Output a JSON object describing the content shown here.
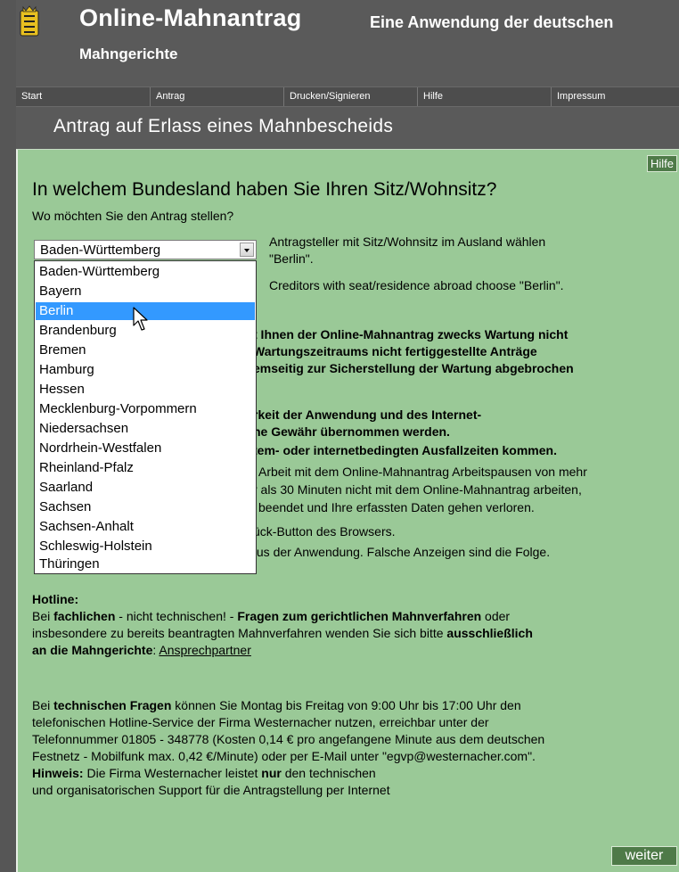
{
  "header": {
    "title": "Online-Mahnantrag",
    "subtitle": "Eine Anwendung der deutschen",
    "subtitle2": "Mahngerichte"
  },
  "nav": {
    "items": [
      "Start",
      "Antrag",
      "Drucken/Signieren",
      "Hilfe",
      "Impressum"
    ]
  },
  "page_title": "Antrag auf Erlass eines Mahnbescheids",
  "help_label": "Hilfe",
  "question": "In welchem Bundesland haben Sie Ihren Sitz/Wohnsitz?",
  "subquestion": "Wo möchten Sie den Antrag stellen?",
  "select": {
    "value": "Baden-Württemberg",
    "options": [
      "Baden-Württemberg",
      "Bayern",
      "Berlin",
      "Brandenburg",
      "Bremen",
      "Hamburg",
      "Hessen",
      "Mecklenburg-Vorpommern",
      "Niedersachsen",
      "Nordrhein-Westfalen",
      "Rheinland-Pfalz",
      "Saarland",
      "Sachsen",
      "Sachsen-Anhalt",
      "Schleswig-Holstein",
      "Thüringen"
    ],
    "highlighted": "Berlin"
  },
  "notes": {
    "abroad_de_1": "Antragsteller mit Sitz/Wohnsitz im Ausland wählen",
    "abroad_de_2": "\"Berlin\".",
    "abroad_en": "Creditors with seat/residence abroad choose \"Berlin\"."
  },
  "maintenance": {
    "line1": "t Ihnen der Online-Mahnantrag zwecks Wartung nicht",
    "line2": "Wartungszeitraums nicht fertiggestellte Anträge",
    "line3": "emseitig zur Sicherstellung der Wartung abgebrochen",
    "line4": "rkeit der Anwendung und des Internet-",
    "line5": "ne Gewähr übernommen werden.",
    "line6": "tem- oder internetbedingten Ausfallzeiten kommen.",
    "line7": "Arbeit mit dem Online-Mahnantrag Arbeitspausen von mehr",
    "line8": "r als 30 Minuten nicht mit dem Online-Mahnantrag arbeiten,",
    "line9": "beendet und Ihre erfassten Daten gehen verloren.",
    "line10": "ück-Button des Browsers.",
    "line11": "tus der Anwendung. Falsche Anzeigen sind die Folge."
  },
  "hotline": {
    "heading": "Hotline:",
    "p1_a": "Bei ",
    "p1_b": "fachlichen",
    "p1_c": " - nicht technischen! - ",
    "p1_d": "Fragen zum gerichtlichen Mahnverfahren",
    "p1_e": " oder",
    "p2_a": "insbesondere zu bereits beantragten Mahnverfahren wenden Sie sich bitte ",
    "p2_b": "ausschließlich",
    "p3_a": "an die Mahngerichte",
    "p3_b": ": ",
    "p3_link": "Ansprechpartner"
  },
  "tech": {
    "l1_a": "Bei ",
    "l1_b": "technischen Fragen",
    "l1_c": " können Sie Montag bis Freitag von 9:00 Uhr bis 17:00 Uhr den",
    "l2": "telefonischen Hotline-Service der Firma Westernacher nutzen, erreichbar unter der",
    "l3": "Telefonnummer 01805 - 348778 (Kosten 0,14 € pro angefangene Minute aus dem deutschen",
    "l4": "Festnetz - Mobilfunk max. 0,42 €/Minute) oder per E-Mail unter \"egvp@westernacher.com\".",
    "l5_a": "Hinweis:",
    "l5_b": " Die Firma Westernacher leistet ",
    "l5_c": "nur",
    "l5_d": " den technischen",
    "l6": "und organisatorischen Support für die Antragstellung per Internet"
  },
  "next_label": "weiter",
  "colors": {
    "header_bg": "#5a5a5a",
    "content_bg": "#9ac997",
    "button_bg": "#4e7a48",
    "highlight": "#3399ff"
  }
}
